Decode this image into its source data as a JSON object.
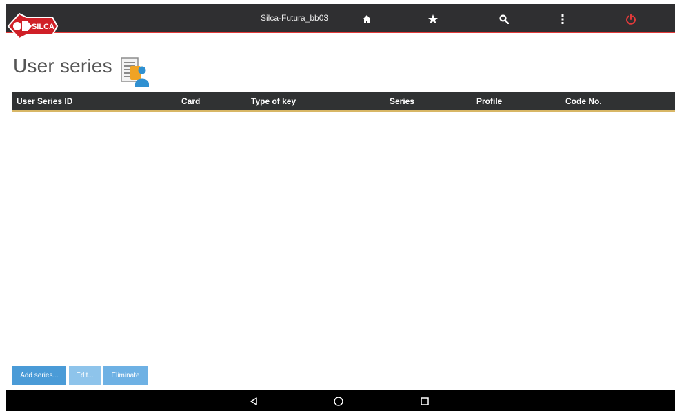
{
  "topbar": {
    "app_title": "Silca-Futura_bb03",
    "logo_text": "SILCA",
    "icons": [
      "home-icon",
      "star-icon",
      "search-icon",
      "more-vert-icon",
      "power-icon"
    ],
    "accent_color": "#e23a3a"
  },
  "page": {
    "title": "User series"
  },
  "table": {
    "columns": [
      "User Series ID",
      "Card",
      "Type of key",
      "Series",
      "Profile",
      "Code No."
    ],
    "rows": []
  },
  "actions": {
    "add_label": "Add series...",
    "edit_label": "Edit...",
    "eliminate_label": "Eliminate"
  },
  "navbar": {
    "icons": [
      "back-icon",
      "home-circle-icon",
      "recents-icon"
    ]
  }
}
